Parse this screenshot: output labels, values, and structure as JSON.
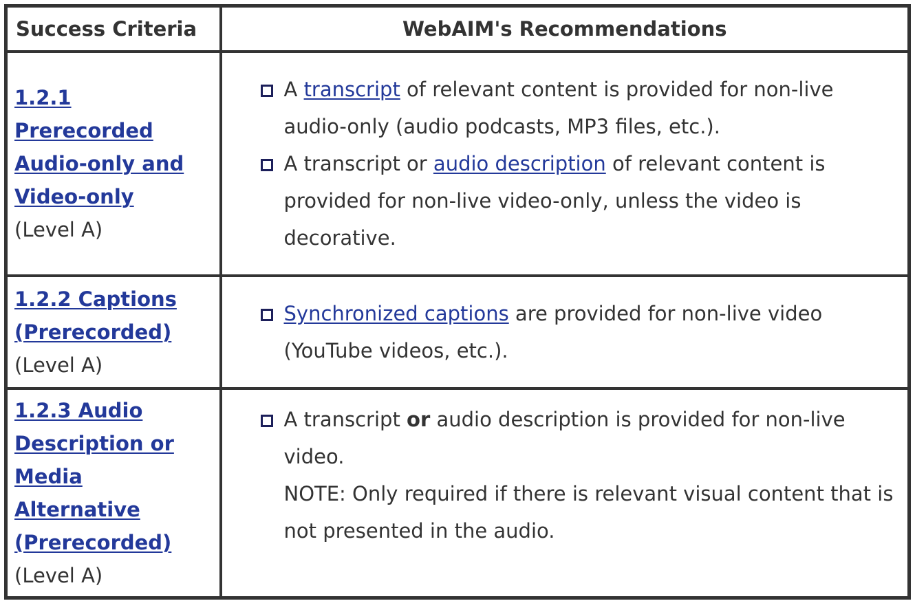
{
  "table": {
    "headers": [
      "Success Criteria",
      "WebAIM's Recommendations"
    ],
    "rows": [
      {
        "criterion": {
          "link_text": "1.2.1 Prerecorded Audio-only and Video-only",
          "level": "(Level A)"
        },
        "recommendations": [
          {
            "parts": [
              "A ",
              {
                "link": "transcript"
              },
              " of relevant content is provided for non-live audio-only (audio podcasts, MP3 files, etc.)."
            ]
          },
          {
            "parts": [
              "A transcript or ",
              {
                "link": "audio description"
              },
              " of relevant content is provided for non-live video-only, unless the video is decorative."
            ]
          }
        ]
      },
      {
        "criterion": {
          "link_text": "1.2.2 Captions (Prerecorded)",
          "level": "(Level A)"
        },
        "recommendations": [
          {
            "parts": [
              {
                "link": "Synchronized captions"
              },
              " are provided for non-live video (YouTube videos, etc.)."
            ]
          }
        ]
      },
      {
        "criterion": {
          "link_text": "1.2.3 Audio Description or Media Alternative (Prerecorded)",
          "level": "(Level A)"
        },
        "recommendations": [
          {
            "parts": [
              "A transcript ",
              {
                "bold": "or"
              },
              " audio description is provided for non-live video."
            ],
            "note": "NOTE: Only required if there is relevant visual content that is not presented in the audio."
          }
        ]
      }
    ]
  },
  "colors": {
    "link": "#23399a",
    "text": "#333333",
    "border": "#333333",
    "bullet": "#1c1f5a"
  }
}
